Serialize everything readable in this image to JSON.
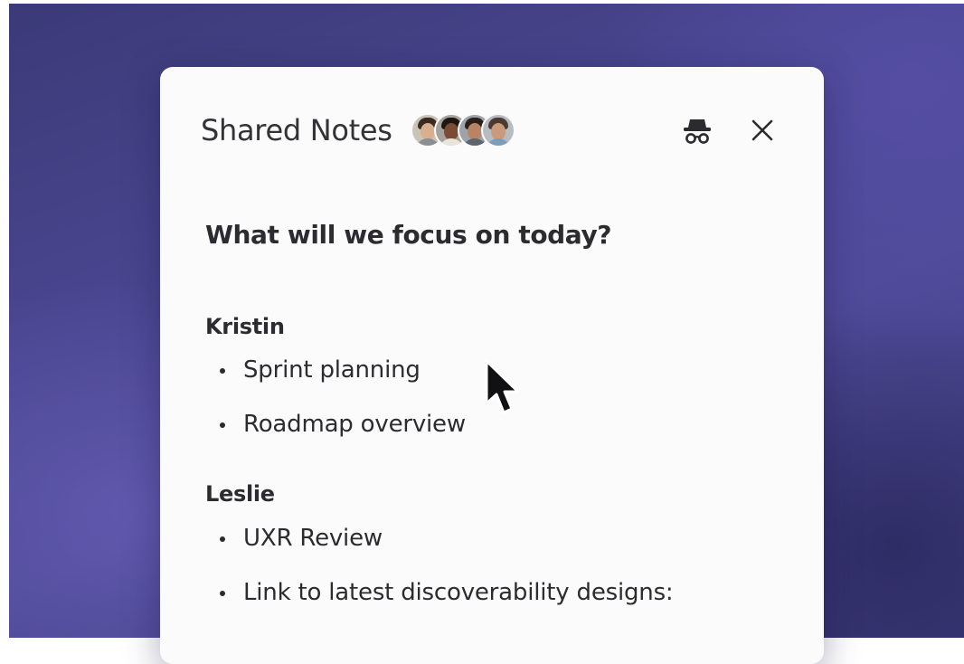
{
  "panel": {
    "title": "Shared Notes",
    "participants": [
      "avatar-1",
      "avatar-2",
      "avatar-3",
      "avatar-4"
    ],
    "actions": {
      "incognito_icon": "incognito-icon",
      "close_icon": "close-icon"
    }
  },
  "doc": {
    "heading": "What will we focus on today?",
    "sections": [
      {
        "name": "Kristin",
        "items": [
          "Sprint planning",
          "Roadmap overview"
        ]
      },
      {
        "name": "Leslie",
        "items": [
          "UXR Review",
          "Link to latest discoverability designs:"
        ]
      }
    ]
  },
  "colors": {
    "background": "#4a4690",
    "panel": "#fbfbfc",
    "text": "#2c2c30"
  }
}
